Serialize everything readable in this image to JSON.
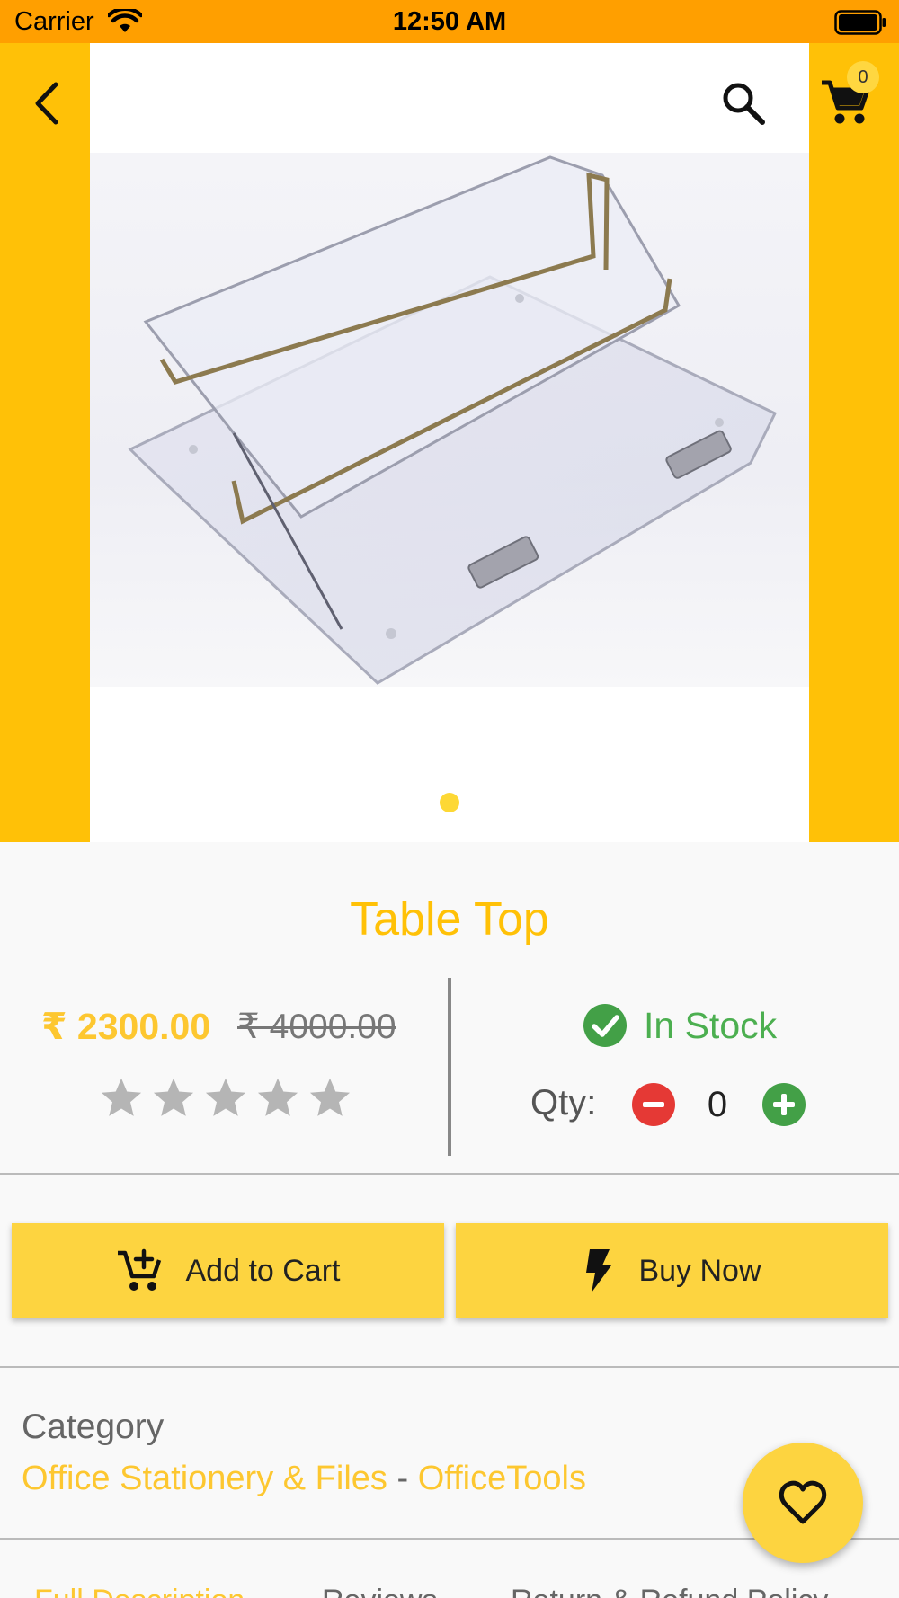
{
  "status_bar": {
    "carrier": "Carrier",
    "time": "12:50 AM"
  },
  "header": {
    "cart_count": "0"
  },
  "product": {
    "title": "Table Top",
    "price": "₹ 2300.00",
    "original_price": "₹ 4000.00",
    "rating_stars_filled": 0,
    "rating_stars_total": 5,
    "stock_status": "In Stock",
    "qty_label": "Qty:",
    "qty_value": "0"
  },
  "actions": {
    "add_to_cart": "Add to Cart",
    "buy_now": "Buy Now"
  },
  "category": {
    "heading": "Category",
    "parent": "Office Stationery & Files",
    "separator": "-",
    "child": "OfficeTools"
  },
  "tabs": [
    {
      "label": "Full Description"
    },
    {
      "label": "Reviews"
    },
    {
      "label": "Return & Refund Policy"
    }
  ],
  "colors": {
    "status_bar": "#FF9F00",
    "brand_yellow": "#FFC107",
    "button_yellow": "#FDD440",
    "in_stock_green": "#4CAF50",
    "minus_red": "#E53935",
    "plus_green": "#43A047"
  },
  "icons": {
    "back": "chevron-left-icon",
    "search": "search-icon",
    "cart": "cart-icon",
    "add_to_cart": "add-shopping-cart-icon",
    "buy_now": "flash-icon",
    "favorite": "heart-outline-icon",
    "stock": "check-circle-icon",
    "rating": "star-icon"
  }
}
